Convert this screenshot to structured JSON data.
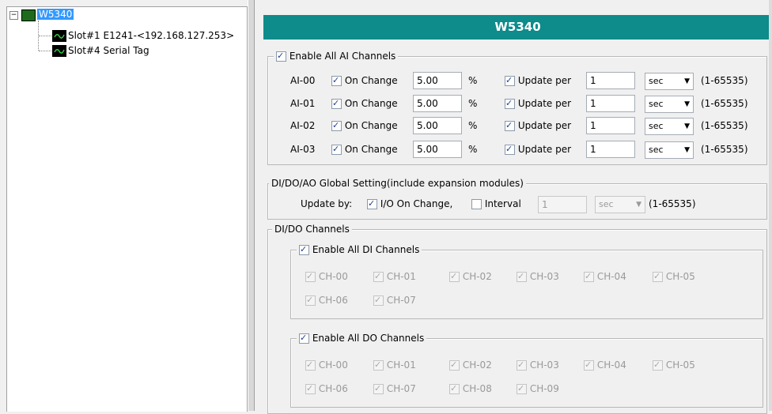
{
  "tree": {
    "root_label": "W5340",
    "children": [
      {
        "label": "Slot#1 E1241-<192.168.127.253>"
      },
      {
        "label": "Slot#4 Serial Tag"
      }
    ]
  },
  "header": {
    "title": "W5340"
  },
  "ai_group": {
    "enable_label": "Enable All AI Channels",
    "enable_checked": true,
    "rows": [
      {
        "name": "AI-00",
        "on_change_label": "On Change",
        "on_change_value": "5.00",
        "unit": "%",
        "update_label": "Update per",
        "update_value": "1",
        "period": "sec",
        "range": "(1-65535)"
      },
      {
        "name": "AI-01",
        "on_change_label": "On Change",
        "on_change_value": "5.00",
        "unit": "%",
        "update_label": "Update per",
        "update_value": "1",
        "period": "sec",
        "range": "(1-65535)"
      },
      {
        "name": "AI-02",
        "on_change_label": "On Change",
        "on_change_value": "5.00",
        "unit": "%",
        "update_label": "Update per",
        "update_value": "1",
        "period": "sec",
        "range": "(1-65535)"
      },
      {
        "name": "AI-03",
        "on_change_label": "On Change",
        "on_change_value": "5.00",
        "unit": "%",
        "update_label": "Update per",
        "update_value": "1",
        "period": "sec",
        "range": "(1-65535)"
      }
    ]
  },
  "global_group": {
    "legend": "DI/DO/AO Global Setting(include expansion modules)",
    "update_by_label": "Update by:",
    "io_change_label": "I/O On Change,",
    "interval_label": "Interval",
    "interval_value": "1",
    "interval_unit": "sec",
    "range": "(1-65535)"
  },
  "dido_group": {
    "legend": "DI/DO Channels",
    "di": {
      "enable_label": "Enable All DI Channels",
      "channels": [
        "CH-00",
        "CH-01",
        "CH-02",
        "CH-03",
        "CH-04",
        "CH-05",
        "CH-06",
        "CH-07"
      ]
    },
    "do": {
      "enable_label": "Enable All DO Channels",
      "channels": [
        "CH-00",
        "CH-01",
        "CH-02",
        "CH-03",
        "CH-04",
        "CH-05",
        "CH-06",
        "CH-07",
        "CH-08",
        "CH-09"
      ]
    }
  },
  "colors": {
    "title_bar": "#0e8b8b",
    "selection": "#3399ff"
  }
}
